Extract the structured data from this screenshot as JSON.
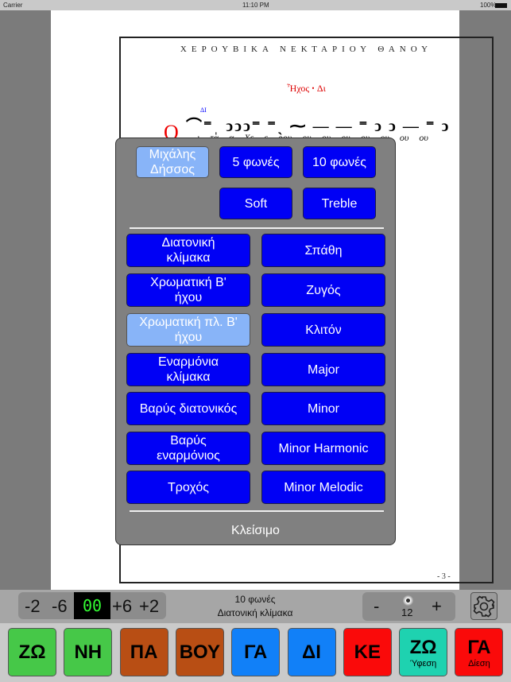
{
  "status": {
    "carrier": "Carrier",
    "time": "11:10 PM",
    "battery": "100%"
  },
  "score": {
    "title": "ΧΕΡΟΥΒΙΚΑ ΝΕΚΤΑΡΙΟΥ ΘΑΝΟΥ",
    "echos": "Ἦχος ꞏ Δι",
    "initial": "O",
    "martyria": "ΔΙ",
    "neumes": "⌒⁼ˌ ͻͻͻ⁼ ⁼ˎ ⁓ — — ⁼ ͻ ͻ — ⁼ ͻ",
    "lyrics": "ι τα α Χε ε ρου ου ου ου ου ου ου ου",
    "page_number": "- 3 -"
  },
  "popup": {
    "voice": "Μιχάλης Δήσσος",
    "five": "5 φωνές",
    "ten": "10 φωνές",
    "soft": "Soft",
    "treble": "Treble",
    "left": [
      "Διατονική κλίμακα",
      "Χρωματική Β' ήχου",
      "Χρωματική πλ. Β' ήχου",
      "Εναρμόνια κλίμακα",
      "Βαρύς διατονικός",
      "Βαρύς εναρμόνιος",
      "Τροχός"
    ],
    "right": [
      "Σπάθη",
      "Ζυγός",
      "Κλιτόν",
      "Major",
      "Minor",
      "Minor Harmonic",
      "Minor Melodic"
    ],
    "close": "Κλείσιμο",
    "colors": {
      "button": "#0000f5",
      "selected": "#88b4f8"
    }
  },
  "toolbar": {
    "m2": "-2",
    "m6": "-6",
    "display": "00",
    "p6": "+6",
    "p2": "+2",
    "line1": "10 φωνές",
    "line2": "Διατονική κλίμακα",
    "minus": "-",
    "volume": "12",
    "plus": "+"
  },
  "keys": [
    {
      "label": "ΖΩ",
      "sub": "",
      "color": "#46c848"
    },
    {
      "label": "ΝΗ",
      "sub": "",
      "color": "#46c848"
    },
    {
      "label": "ΠΑ",
      "sub": "",
      "color": "#b84e14"
    },
    {
      "label": "ΒΟΥ",
      "sub": "",
      "color": "#b84e14"
    },
    {
      "label": "ΓΑ",
      "sub": "",
      "color": "#1180f8"
    },
    {
      "label": "ΔΙ",
      "sub": "",
      "color": "#1180f8"
    },
    {
      "label": "ΚΕ",
      "sub": "",
      "color": "#fa0a0a"
    },
    {
      "label": "ΖΩ",
      "sub": "Ύφεση",
      "color": "#1ed2b0"
    },
    {
      "label": "ΓΑ",
      "sub": "Δίεση",
      "color": "#fa0a0a"
    }
  ]
}
